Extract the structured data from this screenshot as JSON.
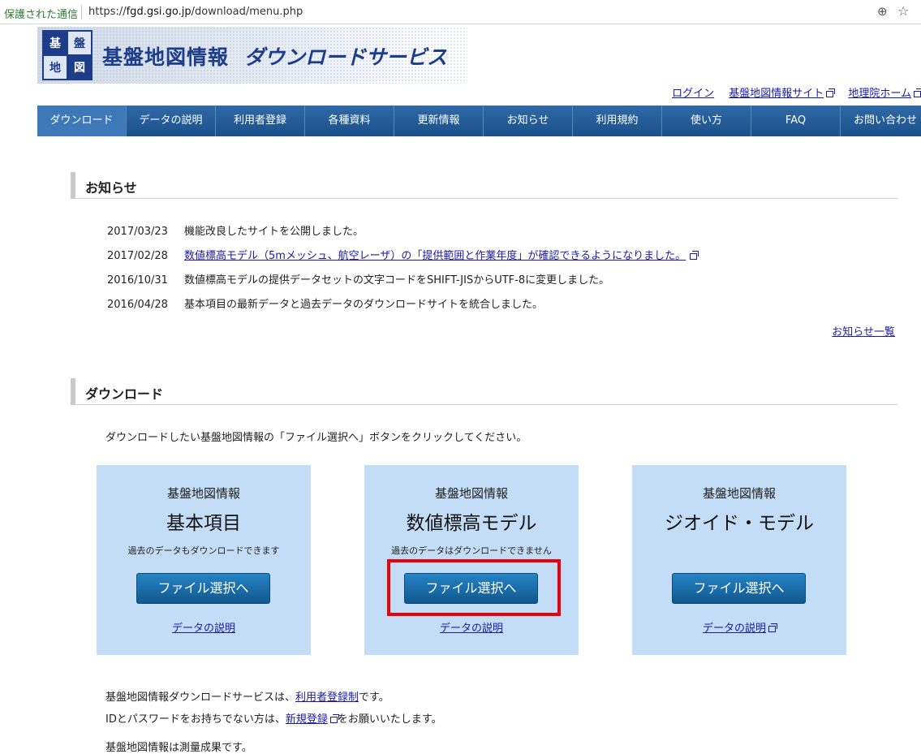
{
  "browser": {
    "secure_label": "保護された通信",
    "url_scheme": "https://",
    "url_host": "fgd.gsi.go.jp",
    "url_path": "/download/menu.php"
  },
  "header": {
    "logo_chars": [
      "基",
      "盤",
      "地",
      "図",
      "情",
      "報"
    ],
    "title": "基盤地図情報",
    "subtitle": "ダウンロードサービス"
  },
  "top_links": [
    {
      "label": "ログイン",
      "external": false
    },
    {
      "label": "基盤地図情報サイト",
      "external": true
    },
    {
      "label": "地理院ホーム",
      "external": true
    }
  ],
  "nav": [
    "ダウンロード",
    "データの説明",
    "利用者登録",
    "各種資料",
    "更新情報",
    "お知らせ",
    "利用規約",
    "使い方",
    "FAQ",
    "お問い合わせ"
  ],
  "news": {
    "title": "お知らせ",
    "items": [
      {
        "date": "2017/03/23",
        "text": "機能改良したサイトを公開しました。",
        "link": false
      },
      {
        "date": "2017/02/28",
        "text": "数値標高モデル（5mメッシュ、航空レーザ）の「提供範囲と作業年度」が確認できるようになりました。",
        "link": true
      },
      {
        "date": "2016/10/31",
        "text": "数値標高モデルの提供データセットの文字コードをSHIFT-JISからUTF-8に変更しました。",
        "link": false
      },
      {
        "date": "2016/04/28",
        "text": "基本項目の最新データと過去データのダウンロードサイトを統合しました。",
        "link": false
      }
    ],
    "more_label": "お知らせ一覧"
  },
  "download": {
    "title": "ダウンロード",
    "instruction": "ダウンロードしたい基盤地図情報の「ファイル選択へ」ボタンをクリックしてください。",
    "cards": [
      {
        "kicker": "基盤地図情報",
        "name": "基本項目",
        "note": "過去のデータもダウンロードできます",
        "button": "ファイル選択へ",
        "desc": "データの説明",
        "external": false
      },
      {
        "kicker": "基盤地図情報",
        "name": "数値標高モデル",
        "note": "過去のデータはダウンロードできません",
        "button": "ファイル選択へ",
        "desc": "データの説明",
        "external": false
      },
      {
        "kicker": "基盤地図情報",
        "name": "ジオイド・モデル",
        "note": "",
        "button": "ファイル選択へ",
        "desc": "データの説明",
        "external": true
      }
    ]
  },
  "footer": {
    "line1_pre": "基盤地図情報ダウンロードサービスは、",
    "line1_link": "利用者登録制",
    "line1_post": "です。",
    "line2_pre": "IDとパスワードをお持ちでない方は、",
    "line2_link": "新規登録",
    "line2_post": "をお願いいたします。",
    "line3_partial": "基盤地図情報は測量成果です。"
  }
}
